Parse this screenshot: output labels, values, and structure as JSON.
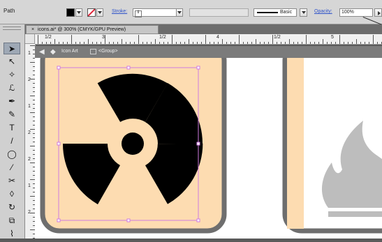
{
  "control_bar": {
    "selection_label": "Path",
    "stroke_label": "Stroke:",
    "brush_label": "Basic",
    "opacity_label": "Opacity:",
    "opacity_value": "100%"
  },
  "document_tab": {
    "close_glyph": "×",
    "title": "icons.ai* @ 300% (CMYK/GPU Preview)"
  },
  "ruler": {
    "h_labels": [
      "1/2",
      "3",
      "1/2",
      "4",
      "1/2",
      "5"
    ],
    "v_labels": [
      "1",
      "2",
      "1",
      "2",
      "2",
      "1",
      "2"
    ]
  },
  "isolation_bar": {
    "layer_name": "Icon Art",
    "group_label": "<Group>"
  },
  "tools": [
    {
      "name": "selection-tool-icon",
      "glyph": "➤",
      "selected": true
    },
    {
      "name": "direct-selection-tool-icon",
      "glyph": "↖"
    },
    {
      "name": "magic-wand-tool-icon",
      "glyph": "✧"
    },
    {
      "name": "lasso-tool-icon",
      "glyph": "ℒ"
    },
    {
      "name": "pen-tool-icon",
      "glyph": "✒"
    },
    {
      "name": "curvature-tool-icon",
      "glyph": "✎"
    },
    {
      "name": "type-tool-icon",
      "glyph": "T"
    },
    {
      "name": "line-tool-icon",
      "glyph": "/"
    },
    {
      "name": "ellipse-tool-icon",
      "glyph": "◯"
    },
    {
      "name": "paintbrush-tool-icon",
      "glyph": "⁄"
    },
    {
      "name": "shaper-tool-icon",
      "glyph": "✂"
    },
    {
      "name": "eraser-tool-icon",
      "glyph": "◊"
    },
    {
      "name": "rotate-tool-icon",
      "glyph": "↻"
    },
    {
      "name": "scale-tool-icon",
      "glyph": "⧉"
    },
    {
      "name": "warp-tool-icon",
      "glyph": "⌇"
    }
  ],
  "colors": {
    "artboard_fill": "#fddcb1",
    "icon_frame": "#6e6e6e",
    "selection": "#d07be0",
    "symbol": "#000000",
    "flame": "#bdbdbd"
  }
}
